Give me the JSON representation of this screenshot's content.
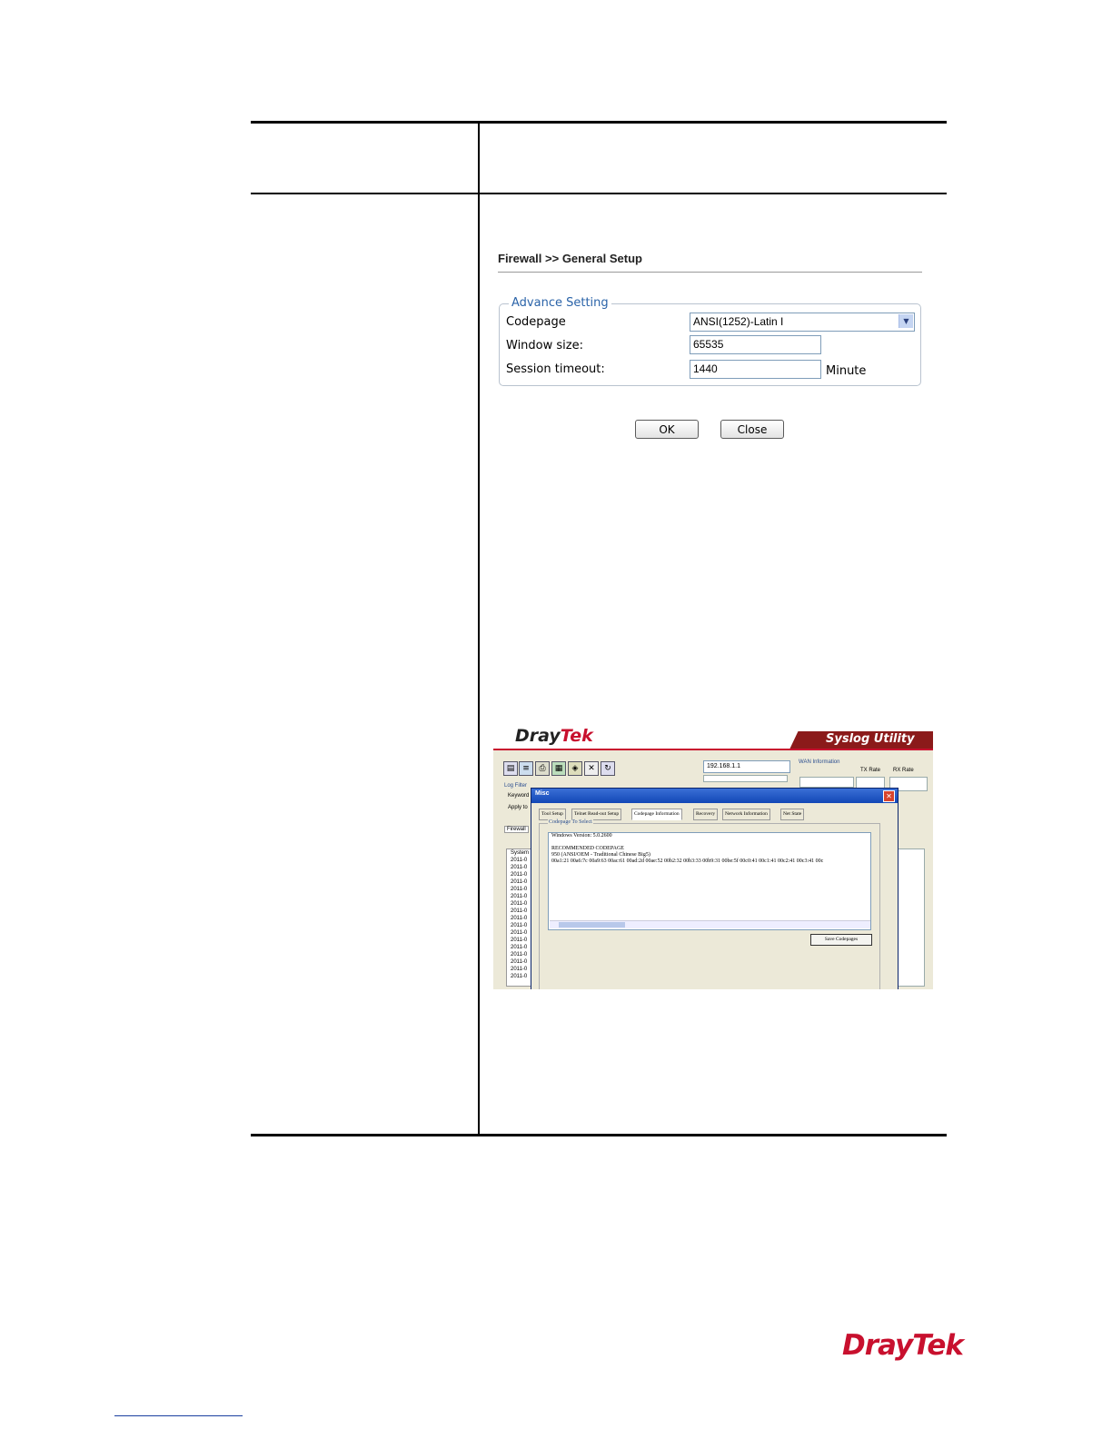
{
  "firewall": {
    "title": "Firewall >> General Setup",
    "legend": "Advance Setting",
    "codepage_label": "Codepage",
    "codepage_value": "ANSI(1252)-Latin I",
    "window_size_label": "Window size:",
    "window_size_value": "65535",
    "session_timeout_label": "Session timeout:",
    "session_timeout_value": "1440",
    "session_timeout_unit": "Minute",
    "ok_label": "OK",
    "close_label": "Close"
  },
  "syslog": {
    "logo_dray": "Dray",
    "logo_tek": "Tek",
    "banner": "Syslog Utility",
    "ip": "192.168.1.1",
    "wan_info": "WAN Information",
    "tx_rate": "TX Rate",
    "rx_rate": "RX Rate",
    "log_filter": "Log Filter",
    "keyword": "Keyword",
    "apply": "Apply to",
    "firewall_tab": "Firewall",
    "system_col": "System",
    "log_rows": [
      "2011-0",
      "2011-0",
      "2011-0",
      "2011-0",
      "2011-0",
      "2011-0",
      "2011-0",
      "2011-0",
      "2011-0",
      "2011-0",
      "2011-0",
      "2011-0",
      "2011-0",
      "2011-0",
      "2011-0",
      "2011-0",
      "2011-0"
    ],
    "misc": {
      "title": "Misc",
      "tabs": [
        "Tool Setup",
        "Telnet Read-out Setup",
        "Codepage Information",
        "Recovery",
        "Network Information",
        "Net State"
      ],
      "group": "Codepage To Select",
      "lines": [
        "Windows Version: 5.0.2600",
        "",
        "RECOMMENDED CODEPAGE",
        "950   (ANSI/OEM - Traditional Chinese Big5)",
        "00a1:21 00a6:7c 00a9:63 00ac:61 00ad:2d 00ae:52 00b2:32 00b3:33 00b9:31 00be:5f 00c0:41 00c1:41 00c2:41 00c3:41 00c"
      ],
      "save_button": "Save Codepages"
    }
  },
  "brand": {
    "dray": "Dray",
    "tek": "Tek"
  }
}
